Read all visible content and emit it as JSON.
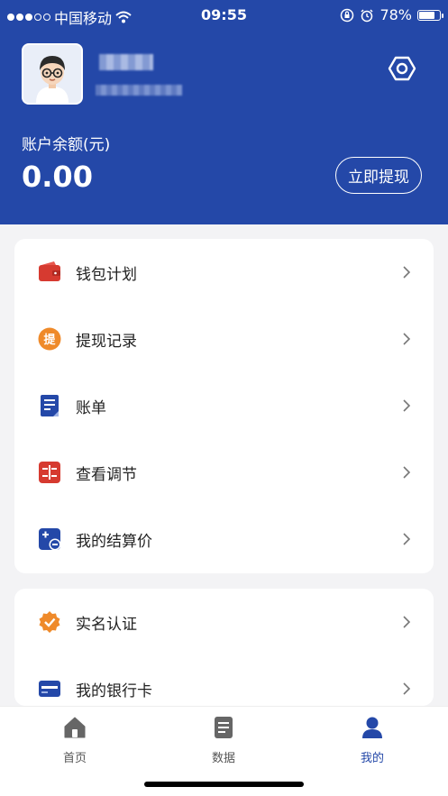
{
  "status_bar": {
    "carrier": "中国移动",
    "time": "09:55",
    "battery": "78%",
    "battery_level": 0.78
  },
  "profile": {
    "balance_label": "账户余额(元)",
    "balance_value": "0.00",
    "withdraw_label": "立即提现"
  },
  "menu_group_1": [
    {
      "label": "钱包计划",
      "icon": "wallet-icon"
    },
    {
      "label": "提现记录",
      "icon": "withdraw-icon"
    },
    {
      "label": "账单",
      "icon": "bill-icon"
    },
    {
      "label": "查看调节",
      "icon": "adjust-icon"
    },
    {
      "label": "我的结算价",
      "icon": "settlement-icon"
    }
  ],
  "menu_group_2": [
    {
      "label": "实名认证",
      "icon": "verify-icon"
    },
    {
      "label": "我的银行卡",
      "icon": "bank-card-icon"
    }
  ],
  "withdraw_icon_char": "提",
  "tabbar": [
    {
      "label": "首页",
      "icon": "home-icon"
    },
    {
      "label": "数据",
      "icon": "data-icon"
    },
    {
      "label": "我的",
      "icon": "profile-icon"
    }
  ],
  "colors": {
    "brand": "#2448a8",
    "red": "#d63a30",
    "orange": "#ef8a2a"
  }
}
